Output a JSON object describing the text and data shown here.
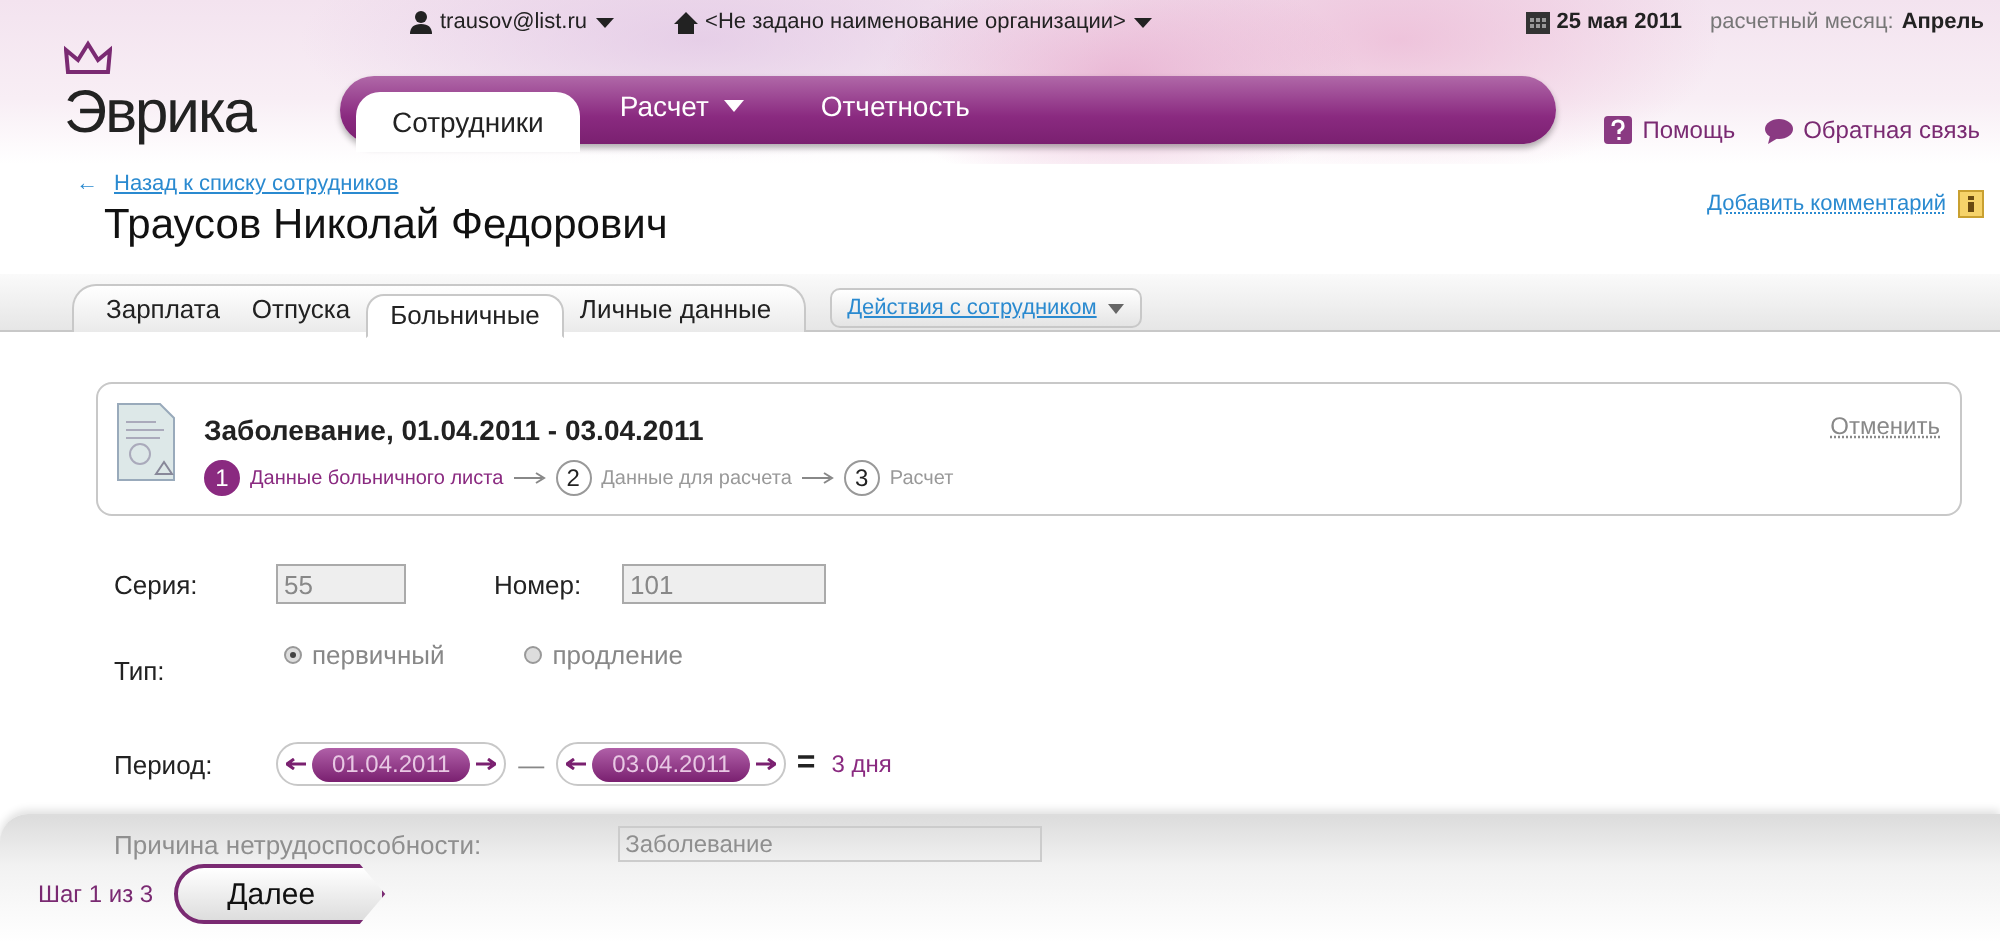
{
  "header": {
    "logo": "Эврика",
    "user": "trausov@list.ru",
    "organization": "<Не задано наименование организации>",
    "date": "25 мая 2011",
    "month_label": "расчетный месяц:",
    "month": "Апрель",
    "nav": [
      {
        "label": "Сотрудники",
        "selected": true,
        "dropdown": false
      },
      {
        "label": "Расчет",
        "selected": false,
        "dropdown": true
      },
      {
        "label": "Отчетность",
        "selected": false,
        "dropdown": false
      }
    ],
    "links": [
      {
        "kind": "help",
        "label": "Помощь"
      },
      {
        "kind": "feedback",
        "label": "Обратная связь"
      }
    ]
  },
  "employee": {
    "back_arrow": "←",
    "back_link": "Назад к списку сотрудников",
    "name": "Траусов Николай Федорович",
    "add_comment": "Добавить комментарий"
  },
  "subtabs": [
    {
      "label": "Зарплата",
      "selected": false
    },
    {
      "label": "Отпуска",
      "selected": false
    },
    {
      "label": "Больничные",
      "selected": true
    },
    {
      "label": "Личные данные",
      "selected": false
    }
  ],
  "actions": "Действия с сотрудником",
  "wizard": {
    "title": "Заболевание, 01.04.2011 - 03.04.2011",
    "cancel": "Отменить",
    "steps": [
      {
        "number": "1",
        "label": "Данные больничного листа",
        "selected": true
      },
      {
        "number": "2",
        "label": "Данные для расчета",
        "selected": false
      },
      {
        "number": "3",
        "label": "Расчет",
        "selected": false
      }
    ]
  },
  "form": {
    "series_label": "Серия:",
    "series": "55",
    "number_label": "Номер:",
    "number": "101",
    "type_label": "Тип:",
    "types": [
      {
        "label": "первичный",
        "selected": true
      },
      {
        "label": "продление",
        "selected": false
      }
    ],
    "period_label": "Период:",
    "from": "01.04.2011",
    "dash": "—",
    "to": "03.04.2011",
    "equals": "=",
    "duration": "3 дня",
    "reason_label": "Причина нетрудоспособности:",
    "reason": "Заболевание"
  },
  "footer": {
    "step": "Шаг 1 из 3",
    "next": "Далее"
  }
}
